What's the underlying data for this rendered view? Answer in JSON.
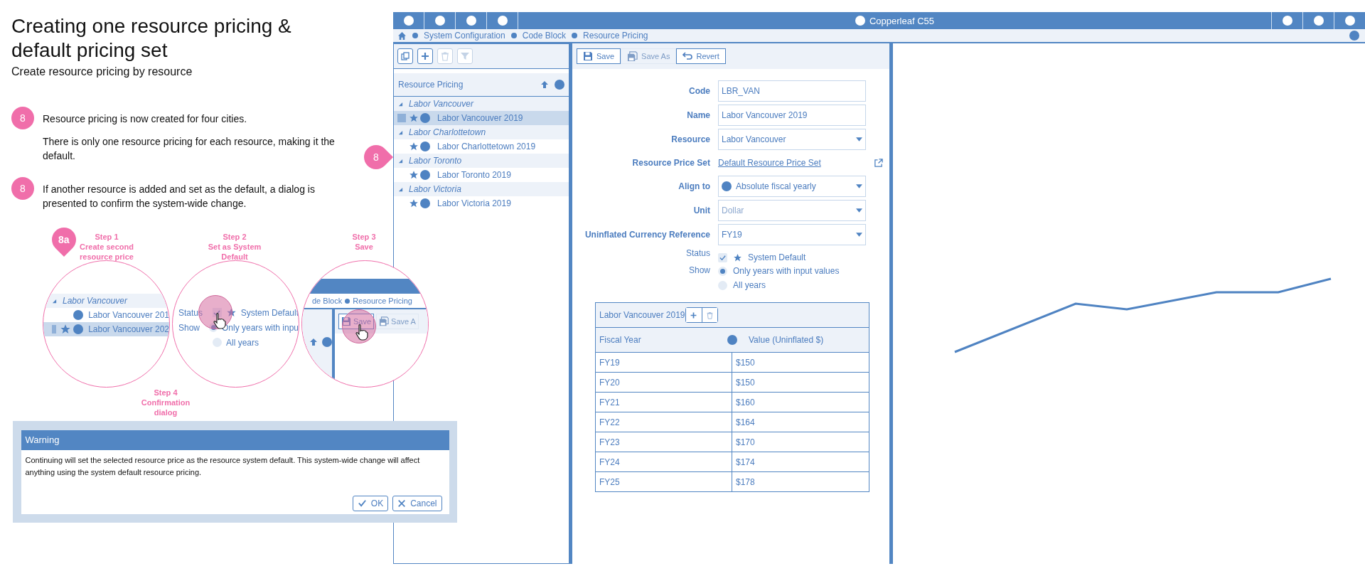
{
  "heading": {
    "title": "Creating one resource pricing & default pricing set",
    "subtitle": "Create resource pricing by resource"
  },
  "notes": [
    {
      "badge": "8",
      "paragraphs": [
        "Resource pricing is now created for four cities.",
        "There is only one resource pricing for each resource, making it the default."
      ]
    },
    {
      "badge": "8",
      "paragraphs": [
        "If another resource is added and set as the default, a dialog  is presented to confirm the system-wide change."
      ]
    }
  ],
  "callout_pin": "8",
  "step_pin": "8a",
  "steps": [
    {
      "label": "Step 1",
      "caption": "Create second resource price"
    },
    {
      "label": "Step 2",
      "caption": "Set as System Default"
    },
    {
      "label": "Step 3",
      "caption": "Save"
    },
    {
      "label": "Step 4",
      "caption": "Confirmation dialog"
    }
  ],
  "magnifiers": [
    {
      "kind": "tree",
      "group": "Labor Vancouver",
      "expanded": true,
      "items": [
        {
          "label": "Labor Vancouver 201",
          "selected": false,
          "default": false
        },
        {
          "label": "Labor Vancouver 202",
          "selected": true,
          "default": true
        }
      ]
    },
    {
      "kind": "form",
      "status_label": "Status",
      "checked": true,
      "clicked": true,
      "default_label": "System Default",
      "show_label": "Show",
      "options": [
        {
          "label": "Only years with inpu",
          "selected": true
        },
        {
          "label": "All years",
          "selected": false
        }
      ]
    },
    {
      "kind": "toolbar",
      "breadcrumb": [
        "de Block",
        "Resource Pricing"
      ],
      "buttons": [
        {
          "kind": "save",
          "label": "Save",
          "disabled": false,
          "clicked": true
        },
        {
          "kind": "save-as",
          "label": "Save A",
          "disabled": true,
          "clicked": false
        }
      ]
    }
  ],
  "dialog": {
    "title": "Warning",
    "message": "Continuing will set the selected resource price as the resource system default. This system-wide change will affect anything using the system default resource pricing.",
    "buttons": [
      {
        "kind": "ok",
        "label": "OK"
      },
      {
        "kind": "cancel",
        "label": "Cancel"
      }
    ]
  },
  "app": {
    "title": "Copperleaf C55",
    "breadcrumb": [
      "System Configuration",
      "Code Block",
      "Resource Pricing"
    ],
    "tree_tools": [
      {
        "kind": "copy",
        "disabled": false
      },
      {
        "kind": "add",
        "disabled": false
      },
      {
        "kind": "delete",
        "disabled": true
      },
      {
        "kind": "filter",
        "disabled": true
      }
    ],
    "tree_title": "Resource Pricing",
    "tree": [
      {
        "label": "Labor Vancouver",
        "expanded": true,
        "children": [
          {
            "label": "Labor Vancouver 2019",
            "selected": true,
            "default": true
          }
        ]
      },
      {
        "label": "Labor Charlottetown",
        "expanded": true,
        "children": [
          {
            "label": "Labor Charlottetown 2019",
            "selected": false,
            "default": true
          }
        ]
      },
      {
        "label": "Labor Toronto",
        "expanded": true,
        "children": [
          {
            "label": "Labor Toronto 2019",
            "selected": false,
            "default": true
          }
        ]
      },
      {
        "label": "Labor Victoria",
        "expanded": true,
        "children": [
          {
            "label": "Labor Victoria 2019",
            "selected": false,
            "default": true
          }
        ]
      }
    ],
    "toolbar": [
      {
        "kind": "save",
        "label": "Save",
        "disabled": false
      },
      {
        "kind": "save-as",
        "label": "Save As",
        "disabled": true
      },
      {
        "kind": "revert",
        "label": "Revert",
        "disabled": false
      }
    ],
    "form": [
      {
        "kind": "text",
        "label": "Code",
        "value": "LBR_VAN"
      },
      {
        "kind": "text",
        "label": "Name",
        "value": "Labor Vancouver 2019"
      },
      {
        "kind": "select",
        "label": "Resource",
        "value": "Labor Vancouver",
        "disabled": false
      },
      {
        "kind": "link",
        "label": "Resource Price Set",
        "value": "Default Resource Price Set"
      },
      {
        "kind": "select",
        "label": "Align to",
        "value": "Absolute fiscal yearly",
        "disabled": false,
        "dot": true
      },
      {
        "kind": "select",
        "label": "Unit",
        "value": "Dollar",
        "disabled": true
      },
      {
        "kind": "select",
        "label": "Uninflated Currency Reference",
        "value": "FY19",
        "disabled": false
      },
      {
        "kind": "check",
        "label": "Status",
        "value": "System Default",
        "checked": true
      },
      {
        "kind": "radio",
        "label": "Show",
        "options": [
          {
            "label": "Only years with input values",
            "selected": true
          },
          {
            "label": "All years",
            "selected": false
          }
        ]
      }
    ],
    "table": {
      "title": "Labor Vancouver 2019",
      "columns": [
        "Fiscal Year",
        "Value (Uninflated $)"
      ],
      "rows": [
        [
          "FY19",
          "$150"
        ],
        [
          "FY20",
          "$150"
        ],
        [
          "FY21",
          "$160"
        ],
        [
          "FY22",
          "$164"
        ],
        [
          "FY23",
          "$170"
        ],
        [
          "FY24",
          "$174"
        ],
        [
          "FY25",
          "$178"
        ]
      ]
    }
  }
}
